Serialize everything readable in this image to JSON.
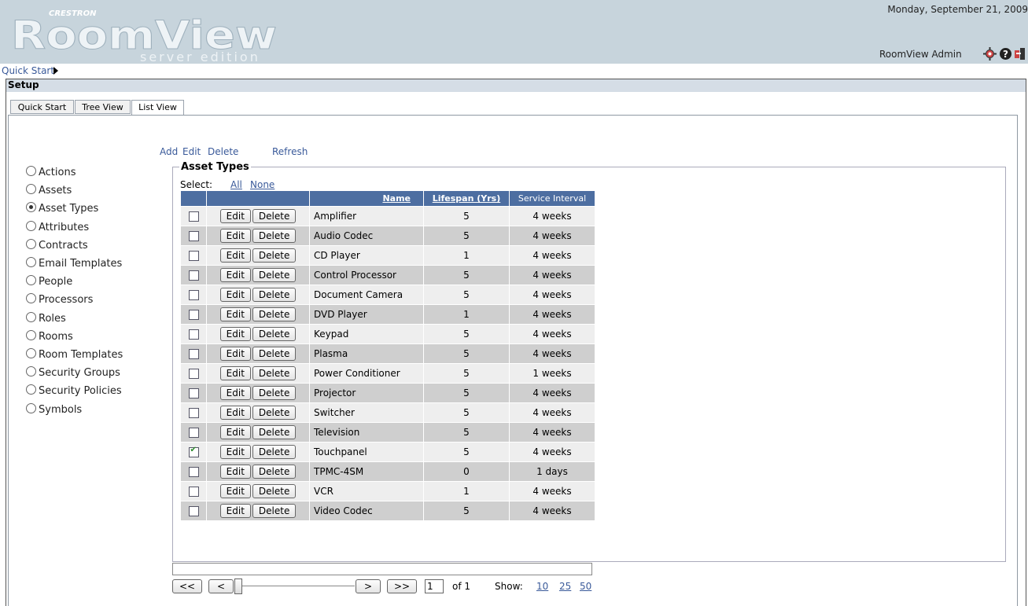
{
  "header": {
    "logo_brand": "CRESTRON",
    "logo_title": "RoomView",
    "logo_subtitle": "server edition",
    "date": "Monday, September 21, 2009",
    "user": "RoomView Admin"
  },
  "quickstart_link": "Quick Start",
  "setup_title": "Setup",
  "tabs": [
    "Quick Start",
    "Tree View",
    "List View"
  ],
  "active_tab": "List View",
  "nav": {
    "selected": "Asset Types",
    "items": [
      "Actions",
      "Assets",
      "Asset Types",
      "Attributes",
      "Contracts",
      "Email Templates",
      "People",
      "Processors",
      "Roles",
      "Rooms",
      "Room Templates",
      "Security Groups",
      "Security Policies",
      "Symbols"
    ]
  },
  "actions": {
    "add": "Add",
    "edit": "Edit",
    "delete": "Delete",
    "refresh": "Refresh"
  },
  "panel": {
    "legend": "Asset Types",
    "select_label": "Select:",
    "select_all": "All",
    "select_none": "None"
  },
  "table": {
    "headers": {
      "name": "Name",
      "lifespan": "Lifespan (Yrs)",
      "service": "Service Interval"
    },
    "edit_label": "Edit",
    "delete_label": "Delete",
    "rows": [
      {
        "name": "Amplifier",
        "lifespan": "5",
        "service": "4 weeks",
        "checked": false
      },
      {
        "name": "Audio Codec",
        "lifespan": "5",
        "service": "4 weeks",
        "checked": false
      },
      {
        "name": "CD Player",
        "lifespan": "1",
        "service": "4 weeks",
        "checked": false
      },
      {
        "name": "Control Processor",
        "lifespan": "5",
        "service": "4 weeks",
        "checked": false
      },
      {
        "name": "Document Camera",
        "lifespan": "5",
        "service": "4 weeks",
        "checked": false
      },
      {
        "name": "DVD Player",
        "lifespan": "1",
        "service": "4 weeks",
        "checked": false
      },
      {
        "name": "Keypad",
        "lifespan": "5",
        "service": "4 weeks",
        "checked": false
      },
      {
        "name": "Plasma",
        "lifespan": "5",
        "service": "4 weeks",
        "checked": false
      },
      {
        "name": "Power Conditioner",
        "lifespan": "5",
        "service": "1 weeks",
        "checked": false
      },
      {
        "name": "Projector",
        "lifespan": "5",
        "service": "4 weeks",
        "checked": false
      },
      {
        "name": "Switcher",
        "lifespan": "5",
        "service": "4 weeks",
        "checked": false
      },
      {
        "name": "Television",
        "lifespan": "5",
        "service": "4 weeks",
        "checked": false
      },
      {
        "name": "Touchpanel",
        "lifespan": "5",
        "service": "4 weeks",
        "checked": true
      },
      {
        "name": "TPMC-4SM",
        "lifespan": "0",
        "service": "1 days",
        "checked": false
      },
      {
        "name": "VCR",
        "lifespan": "1",
        "service": "4 weeks",
        "checked": false
      },
      {
        "name": "Video Codec",
        "lifespan": "5",
        "service": "4 weeks",
        "checked": false
      }
    ]
  },
  "pager": {
    "first": "<<",
    "prev": "<",
    "next": ">",
    "last": ">>",
    "page": "1",
    "of_text": "of 1",
    "show_label": "Show:",
    "show_options": [
      "10",
      "25",
      "50"
    ]
  },
  "icons": [
    "config-icon",
    "help-icon",
    "logout-icon"
  ],
  "colors": {
    "header_bg": "#c7d4dc",
    "table_header": "#4d6ea1",
    "link": "#3a5a9a"
  }
}
